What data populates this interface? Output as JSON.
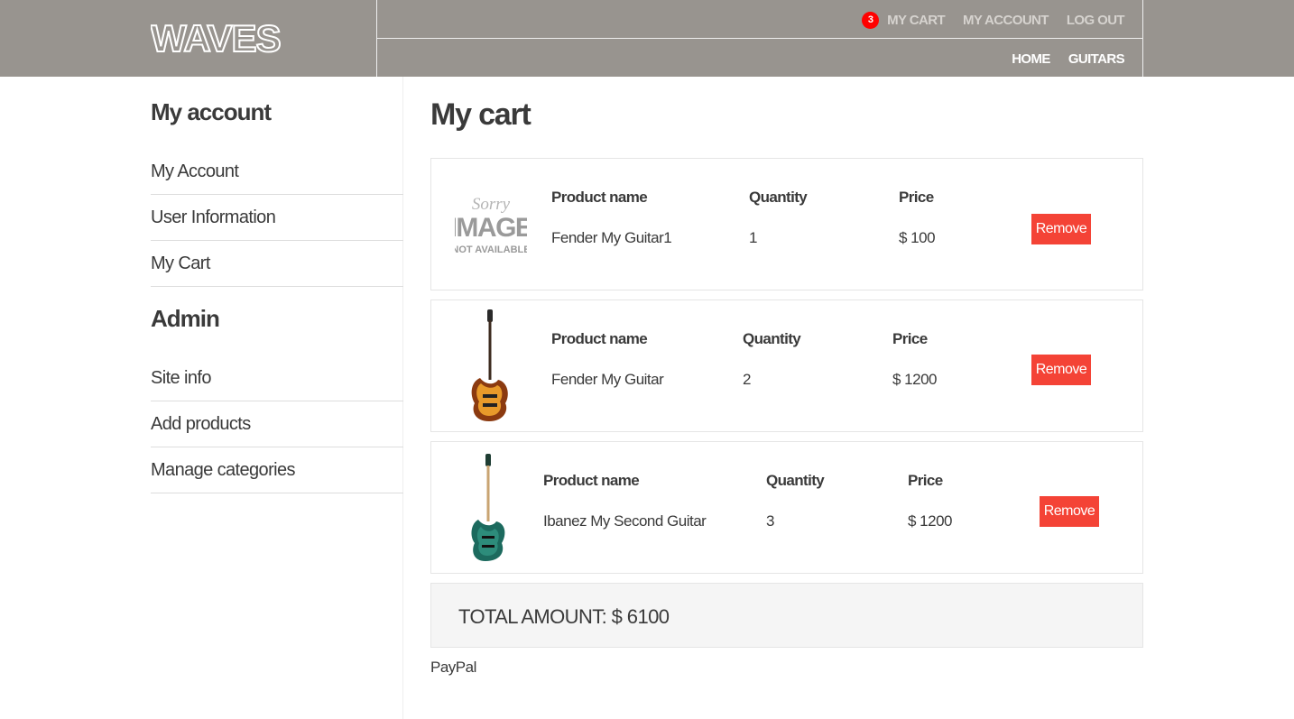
{
  "header": {
    "logo": "WAVES",
    "cart_count": "3",
    "top_links": [
      "MY CART",
      "MY ACCOUNT",
      "LOG OUT"
    ],
    "bottom_links": [
      "HOME",
      "GUITARS"
    ]
  },
  "sidebar": {
    "account_heading": "My account",
    "account_items": [
      "My Account",
      "User Information",
      "My Cart"
    ],
    "admin_heading": "Admin",
    "admin_items": [
      "Site info",
      "Add products",
      "Manage categories"
    ]
  },
  "main": {
    "title": "My cart",
    "labels": {
      "product": "Product name",
      "quantity": "Quantity",
      "price": "Price",
      "remove": "Remove"
    },
    "placeholder_image": {
      "line1": "Sorry",
      "line2": "IMAGE",
      "line3": "NOT AVAILABLE"
    },
    "items": [
      {
        "name": "Fender My Guitar1",
        "quantity": "1",
        "price": "$ 100",
        "image": "image-not-available"
      },
      {
        "name": "Fender My Guitar",
        "quantity": "2",
        "price": "$ 1200",
        "image": "sunburst-guitar"
      },
      {
        "name": "Ibanez My Second Guitar",
        "quantity": "3",
        "price": "$ 1200",
        "image": "green-guitar"
      }
    ],
    "total": "TOTAL AMOUNT: $ 6100",
    "payment": "PayPal"
  },
  "colors": {
    "header_bg": "#98948f",
    "remove_button": "#f44336",
    "badge": "#ff0000"
  }
}
